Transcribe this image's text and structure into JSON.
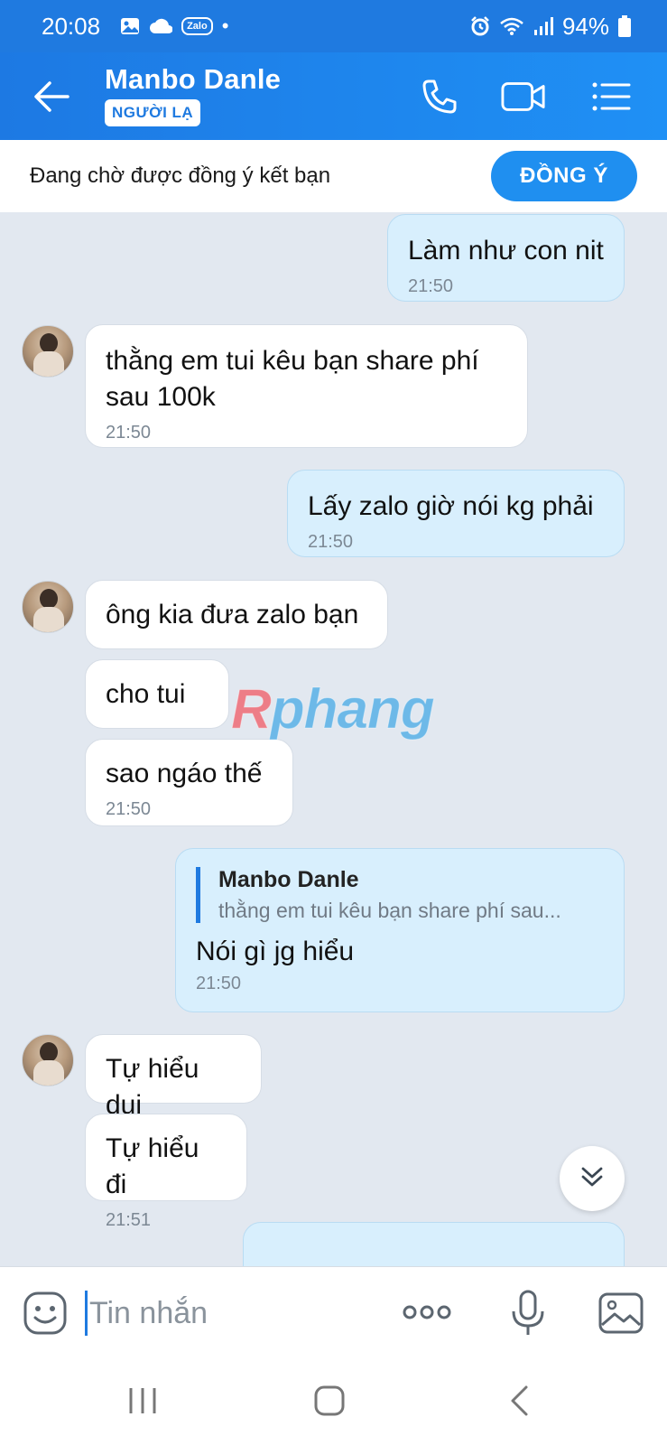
{
  "status_bar": {
    "time": "20:08",
    "zalo_badge": "Zalo",
    "dot": "•",
    "battery": "94%",
    "icons": [
      "image-icon",
      "cloud-icon",
      "zalo-icon",
      "alarm-icon",
      "wifi-icon",
      "signal-icon",
      "battery-icon"
    ]
  },
  "header": {
    "name": "Manbo Danle",
    "badge": "NGƯỜI LẠ",
    "icons": [
      "back-arrow-icon",
      "phone-icon",
      "video-call-icon",
      "menu-icon"
    ]
  },
  "friend_request": {
    "text": "Đang chờ được đồng ý kết bạn",
    "button": "ĐỒNG Ý"
  },
  "messages": [
    {
      "dir": "out",
      "text": "Làm như con nit",
      "time": "21:50"
    },
    {
      "dir": "in",
      "text": "thằng em tui kêu bạn share phí sau  100k",
      "time": "21:50"
    },
    {
      "dir": "out",
      "text": "Lấy zalo giờ nói kg phải",
      "time": "21:50"
    },
    {
      "dir": "in",
      "text": "ông kia đưa zalo bạn",
      "time": ""
    },
    {
      "dir": "in",
      "text": "cho tui",
      "time": ""
    },
    {
      "dir": "in",
      "text": "sao ngáo  thế",
      "time": "21:50"
    },
    {
      "dir": "out",
      "quote_name": "Manbo Danle",
      "quote_text": "thằng em tui kêu bạn share phí  sau...",
      "text": "Nói gì jg hiểu",
      "time": "21:50"
    },
    {
      "dir": "in",
      "text": "Tự hiểu dui",
      "time": ""
    },
    {
      "dir": "in",
      "text": "Tự hiểu đi",
      "time": "21:51"
    }
  ],
  "watermark": {
    "first": "R",
    "rest": "phang"
  },
  "input": {
    "placeholder": "Tin nhắn",
    "icons": [
      "emoji-icon",
      "more-icon",
      "microphone-icon",
      "image-icon"
    ]
  },
  "colors": {
    "brand": "#1f7ae0",
    "outgoing_bubble": "#d8effd",
    "incoming_bubble": "#ffffff",
    "chat_bg": "#e2e8f0"
  }
}
